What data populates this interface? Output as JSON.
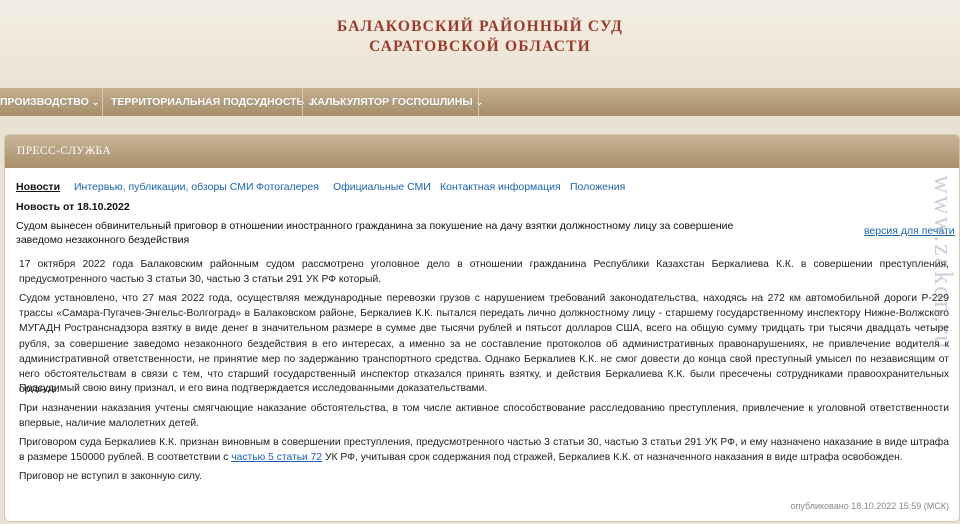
{
  "header": {
    "title_line1": "БАЛАКОВСКИЙ РАЙОННЫЙ СУД",
    "title_line2": "САРАТОВСКОЙ ОБЛАСТИ"
  },
  "menu": {
    "items": [
      {
        "label": "ПРОИЗВОДСТВО"
      },
      {
        "label": "ТЕРРИТОРИАЛЬНАЯ ПОДСУДНОСТЬ"
      },
      {
        "label": "КАЛЬКУЛЯТОР ГОСПОШЛИНЫ"
      }
    ],
    "chevron": "⌄"
  },
  "panel": {
    "title": "ПРЕСС-СЛУЖБА"
  },
  "tabs": [
    {
      "label": "Новости"
    },
    {
      "label": "Интервью, публикации, обзоры СМИ"
    },
    {
      "label": "Фотогалерея"
    },
    {
      "label": "Официальные СМИ"
    },
    {
      "label": "Контактная информация"
    },
    {
      "label": "Положения"
    }
  ],
  "article": {
    "date_label": "Новость от 18.10.2022",
    "headline": "Судом вынесен обвинительный приговор в отношении иностранного гражданина за покушение на дачу взятки должностному лицу за совершение заведомо незаконного бездействия",
    "print_link": "версия для печати",
    "paragraphs": [
      "17 октября 2022 года Балаковским районным судом рассмотрено уголовное дело в отношении гражданина Республики Казахстан Беркалиева К.К. в совершении преступления, предусмотренного частью 3 статьи 30, частью 3 статьи 291 УК РФ который.",
      "Судом установлено, что 27 мая 2022 года, осуществляя международные перевозки грузов с нарушением требований законодательства, находясь на 272 км автомобильной дороги Р-229 трассы «Самара-Пугачев-Энгельс-Волгоград» в Балаковском районе, Беркалиев К.К. пытался передать лично должностному лицу - старшему государственному инспектору Нижне-Волжского МУГАДН Ространснадзора взятку в виде денег в значительном размере в сумме две тысячи рублей и пятьсот долларов США, всего на общую сумму тридцать три тысячи двадцать четыре рубля, за совершение заведомо незаконного бездействия в его интересах, а именно за не составление протоколов об административных правонарушениях, не привлечение водителя к административной ответственности, не принятие мер по задержанию транспортного средства. Однако Беркалиев К.К. не смог довести до конца свой преступный умысел по независящим от него обстоятельствам в связи с тем, что старший государственный инспектор отказался принять взятку, и действия Беркалиева К.К. были пресечены сотрудниками правоохранительных органов.",
      "Подсудимый свою вину признал, и его вина подтверждается исследованными доказательствами.",
      "При назначении наказания учтены смягчающие наказание обстоятельства, в том числе активное способствование расследованию преступления, привлечение к уголовной ответственности впервые, наличие малолетних детей."
    ],
    "sentence_para": {
      "before": "Приговором суда Беркалиев К.К. признан виновным в совершении преступления, предусмотренного частью 3 статьи 30, частью 3 статьи 291 УК РФ, и ему назначено наказание в виде штрафа в размере 150000 рублей. В соответствии с ",
      "link": "частью 5 статьи 72",
      "after": " УК РФ, учитывая срок содержания под стражей, Беркалиев К.К. от назначенного наказания в виде штрафа освобожден."
    },
    "final_para": "Приговор не вступил в законную силу.",
    "published": "опубликовано 18.10.2022 15:59 (МСК)"
  },
  "watermark": "www.zakon.ru"
}
